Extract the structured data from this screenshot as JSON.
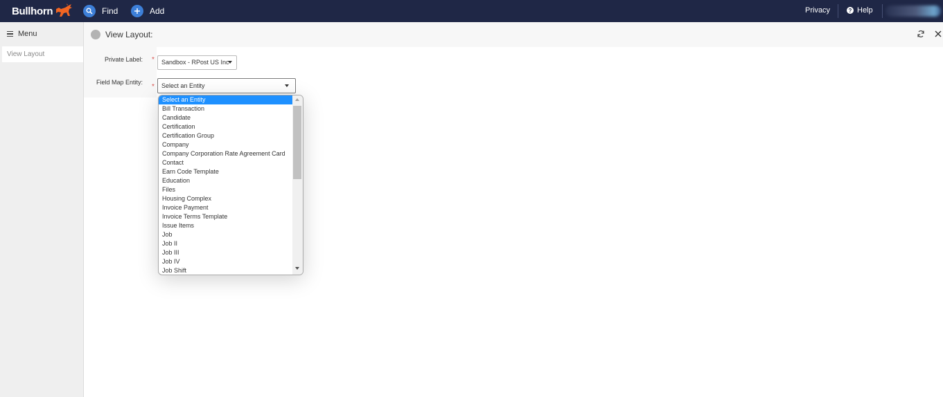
{
  "topbar": {
    "logo_text": "Bullhorn",
    "find_label": "Find",
    "add_label": "Add",
    "privacy_label": "Privacy",
    "help_label": "Help",
    "help_icon_glyph": "?"
  },
  "sidebar": {
    "menu_label": "Menu",
    "items": [
      {
        "label": "View Layout"
      }
    ]
  },
  "header": {
    "title": "View Layout:"
  },
  "form": {
    "private_label": {
      "label": "Private Label:",
      "required_marker": "*",
      "value": "Sandbox - RPost US Inc"
    },
    "field_map_entity": {
      "label": "Field Map Entity:",
      "required_marker": "*",
      "value": "Select an Entity"
    }
  },
  "dropdown": {
    "options": [
      "Select an Entity",
      "Bill Transaction",
      "Candidate",
      "Certification",
      "Certification Group",
      "Company",
      "Company Corporation Rate Agreement Card",
      "Contact",
      "Earn Code Template",
      "Education",
      "Files",
      "Housing Complex",
      "Invoice Payment",
      "Invoice Terms Template",
      "Issue Items",
      "Job",
      "Job II",
      "Job III",
      "Job IV",
      "Job Shift"
    ],
    "selected": "Select an Entity"
  },
  "colors": {
    "topbar_bg": "#1f2746",
    "accent_blue": "#3d7fd8",
    "selected_option": "#1e90ff",
    "required": "#d9534f",
    "brand_orange": "#f26522"
  }
}
